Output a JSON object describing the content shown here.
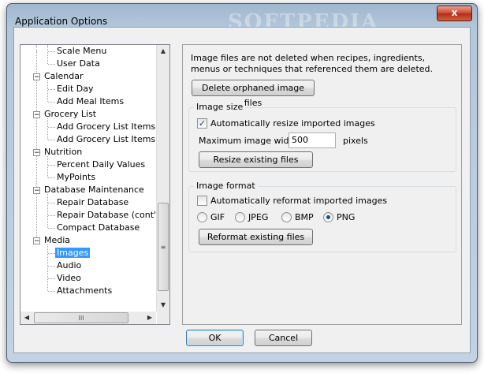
{
  "window": {
    "title": "Application Options",
    "close_glyph": "x",
    "watermark": "SOFTPEDIA"
  },
  "tree": {
    "items": [
      {
        "label": "Scale Menu"
      },
      {
        "label": "User Data"
      },
      {
        "label": "Calendar"
      },
      {
        "label": "Edit Day"
      },
      {
        "label": "Add Meal Items"
      },
      {
        "label": "Grocery List"
      },
      {
        "label": "Add Grocery List Items"
      },
      {
        "label": "Add Grocery List Items (cc"
      },
      {
        "label": "Nutrition"
      },
      {
        "label": "Percent Daily Values"
      },
      {
        "label": "MyPoints"
      },
      {
        "label": "Database Maintenance"
      },
      {
        "label": "Repair Database"
      },
      {
        "label": "Repair Database (cont'd)"
      },
      {
        "label": "Compact Database"
      },
      {
        "label": "Media"
      },
      {
        "label": "Images"
      },
      {
        "label": "Audio"
      },
      {
        "label": "Video"
      },
      {
        "label": "Attachments"
      }
    ],
    "expander_glyph": "−"
  },
  "panel": {
    "description": "Image files are not deleted when recipes, ingredients, menus or techniques that referenced them are deleted.",
    "delete_orphaned_label": "Delete orphaned image files",
    "image_size": {
      "group_label": "Image size",
      "auto_resize_label": "Automatically resize imported images",
      "auto_resize_checked": true,
      "max_width_label": "Maximum image width:",
      "max_width_value": "500",
      "pixels_label": "pixels",
      "resize_button_label": "Resize existing files"
    },
    "image_format": {
      "group_label": "Image format",
      "auto_reformat_label": "Automatically reformat imported images",
      "auto_reformat_checked": false,
      "formats": [
        "GIF",
        "JPEG",
        "BMP",
        "PNG"
      ],
      "selected_format": "PNG",
      "reformat_button_label": "Reformat existing files"
    }
  },
  "buttons": {
    "ok_label": "OK",
    "cancel_label": "Cancel"
  },
  "scroll": {
    "up_glyph": "▲",
    "down_glyph": "▼",
    "left_glyph": "◀",
    "right_glyph": "▶",
    "grip_glyph": "≡",
    "hgrip_glyph": "III"
  },
  "check_glyph": "✓"
}
